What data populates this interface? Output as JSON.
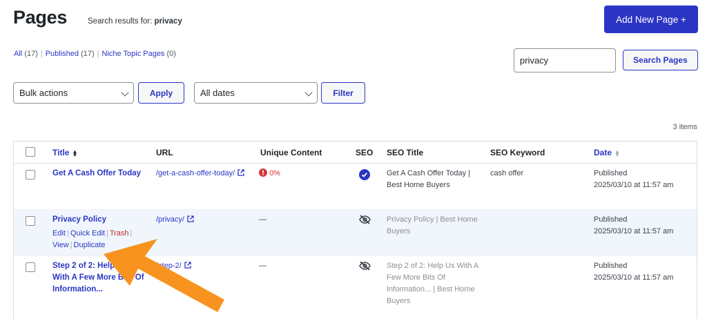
{
  "header": {
    "title": "Pages",
    "search_prefix": "Search results for: ",
    "search_term": "privacy",
    "add_new_label": "Add New Page +"
  },
  "filters": {
    "all_label": "All",
    "all_count": "(17)",
    "published_label": "Published",
    "published_count": "(17)",
    "niche_label": "Niche Topic Pages",
    "niche_count": "(0)"
  },
  "search": {
    "value": "privacy",
    "button_label": "Search Pages"
  },
  "toolbar": {
    "bulk_actions": "Bulk actions",
    "apply_label": "Apply",
    "dates": "All dates",
    "filter_label": "Filter",
    "items_count": "3 items"
  },
  "table": {
    "columns": {
      "title": "Title",
      "url": "URL",
      "unique_content": "Unique Content",
      "seo": "SEO",
      "seo_title": "SEO Title",
      "seo_keyword": "SEO Keyword",
      "date": "Date"
    },
    "rows": [
      {
        "title": "Get A Cash Offer Today",
        "url": "/get-a-cash-offer-today/",
        "unique_content": "0%",
        "seo_status": "check-circle-icon",
        "seo_title_line1": "Get A Cash Offer Today |",
        "seo_title_line2": "Best Home Buyers",
        "seo_keyword": "cash offer",
        "date_status": "Published",
        "date_value": "2025/03/10 at 11:57 am"
      },
      {
        "title": "Privacy Policy",
        "url": "/privacy/",
        "unique_content": "—",
        "seo_status": "eye-slash-icon",
        "seo_title_line1": "Privacy Policy | Best Home",
        "seo_title_line2": "Buyers",
        "seo_keyword": "",
        "date_status": "Published",
        "date_value": "2025/03/10 at 11:57 am",
        "actions": {
          "edit": "Edit",
          "quick_edit": "Quick Edit",
          "trash": "Trash",
          "view": "View",
          "duplicate": "Duplicate"
        }
      },
      {
        "title_line1": "Step 2 of 2: Help Us",
        "title_line2": "With A Few More Bits Of",
        "title_line3": "Information...",
        "url": "/step-2/",
        "unique_content": "—",
        "seo_status": "eye-slash-icon",
        "seo_title_line1": "Step 2 of 2: Help Us With A",
        "seo_title_line2": "Few More Bits Of",
        "seo_title_line3": "Information... | Best Home",
        "seo_title_line4": "Buyers",
        "seo_keyword": "",
        "date_status": "Published",
        "date_value": "2025/03/10 at 11:57 am"
      }
    ]
  },
  "colors": {
    "accent": "#2b35c4",
    "arrow": "#f7931e",
    "warning": "#d63638"
  }
}
